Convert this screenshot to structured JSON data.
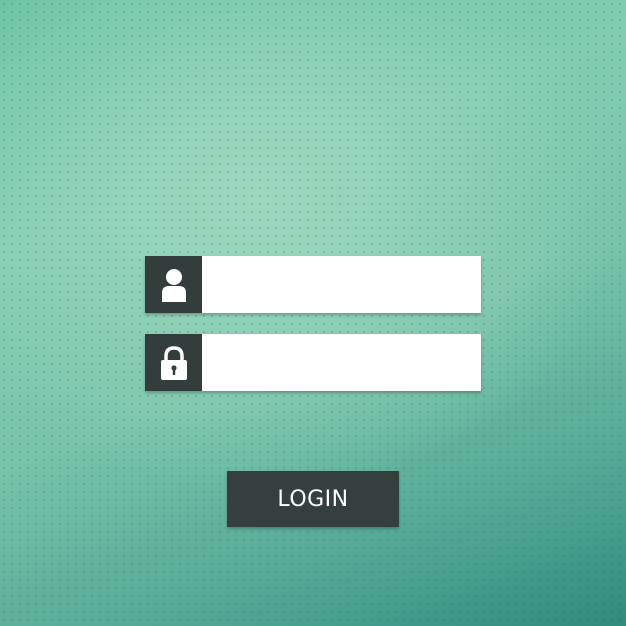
{
  "form": {
    "username": {
      "icon": "user-icon",
      "value": "",
      "placeholder": ""
    },
    "password": {
      "icon": "lock-icon",
      "value": "",
      "placeholder": ""
    },
    "login_label": "LOGIN"
  },
  "colors": {
    "background_light": "#9dd8bf",
    "background_mid": "#78c3aa",
    "background_dark": "#2f8b7d",
    "icon_box": "#333d3c",
    "button": "#353f3e",
    "field": "#ffffff",
    "button_text": "#ffffff"
  }
}
